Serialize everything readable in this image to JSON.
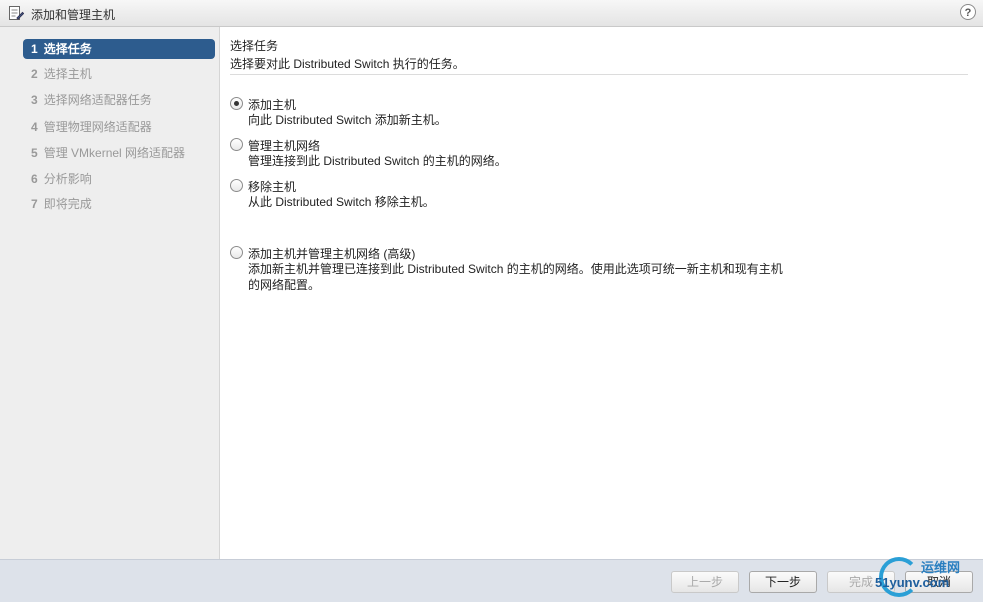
{
  "window": {
    "title": "添加和管理主机",
    "help_label": "?"
  },
  "sidebar": {
    "items": [
      {
        "num": "1",
        "label": "选择任务"
      },
      {
        "num": "2",
        "label": "选择主机"
      },
      {
        "num": "3",
        "label": "选择网络适配器任务"
      },
      {
        "num": "4",
        "label": "管理物理网络适配器"
      },
      {
        "num": "5",
        "label": "管理 VMkernel 网络适配器"
      },
      {
        "num": "6",
        "label": "分析影响"
      },
      {
        "num": "7",
        "label": "即将完成"
      }
    ],
    "active_index": 0
  },
  "main": {
    "title": "选择任务",
    "subtitle": "选择要对此 Distributed Switch 执行的任务。",
    "options": [
      {
        "label": "添加主机",
        "desc": "向此 Distributed Switch 添加新主机。",
        "checked": true
      },
      {
        "label": "管理主机网络",
        "desc": "管理连接到此 Distributed Switch 的主机的网络。",
        "checked": false
      },
      {
        "label": "移除主机",
        "desc": "从此 Distributed Switch 移除主机。",
        "checked": false
      },
      {
        "label": "添加主机并管理主机网络 (高级)",
        "desc": "添加新主机并管理已连接到此 Distributed Switch 的主机的网络。使用此选项可统一新主机和现有主机的网络配置。",
        "checked": false
      }
    ]
  },
  "footer": {
    "back_label": "上一步",
    "next_label": "下一步",
    "finish_label": "完成",
    "cancel_label": "取消"
  },
  "watermark": {
    "top": "运维网",
    "bottom": "51yunv.com"
  },
  "colors": {
    "active_step_bg": "#2d5c8e",
    "footer_bg": "#dde2ea",
    "sidebar_bg": "#eeeeee"
  }
}
